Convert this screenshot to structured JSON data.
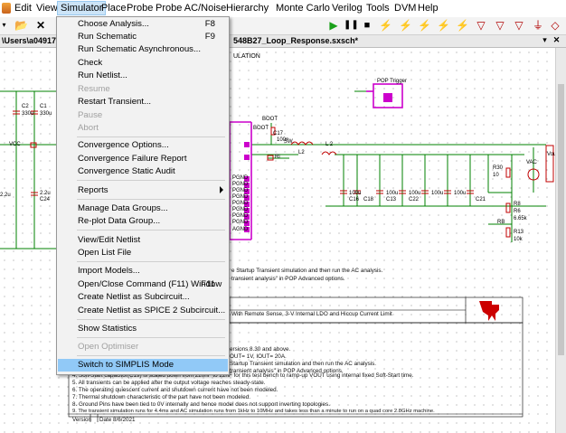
{
  "menubar": {
    "items": [
      "Edit",
      "View",
      "Simulator",
      "Place",
      "Probe",
      "Probe AC/Noise",
      "Hierarchy",
      "Monte Carlo",
      "Verilog",
      "Tools",
      "DVM",
      "Help"
    ]
  },
  "tabbar": {
    "path": "\\Users\\a049170",
    "document": "548B27_Loop_Response.sxsch*"
  },
  "simulator_menu": {
    "items": [
      {
        "label": "Choose Analysis...",
        "shortcut": "F8",
        "enabled": true
      },
      {
        "label": "Run Schematic",
        "shortcut": "F9",
        "enabled": true
      },
      {
        "label": "Run Schematic Asynchronous...",
        "shortcut": "",
        "enabled": true
      },
      {
        "label": "Check",
        "shortcut": "",
        "enabled": true
      },
      {
        "label": "Run Netlist...",
        "shortcut": "",
        "enabled": true
      },
      {
        "label": "Resume",
        "shortcut": "",
        "enabled": false
      },
      {
        "label": "Restart Transient...",
        "shortcut": "",
        "enabled": true
      },
      {
        "label": "Pause",
        "shortcut": "",
        "enabled": false
      },
      {
        "label": "Abort",
        "shortcut": "",
        "enabled": false
      },
      {
        "label": "Convergence Options...",
        "shortcut": "",
        "enabled": true
      },
      {
        "label": "Convergence Failure Report",
        "shortcut": "",
        "enabled": true
      },
      {
        "label": "Convergence Static Audit",
        "shortcut": "",
        "enabled": true
      },
      {
        "label": "Reports",
        "shortcut": "",
        "enabled": true,
        "submenu": true
      },
      {
        "label": "Manage Data Groups...",
        "shortcut": "",
        "enabled": true
      },
      {
        "label": "Re-plot Data Group...",
        "shortcut": "",
        "enabled": true
      },
      {
        "label": "View/Edit Netlist",
        "shortcut": "",
        "enabled": true
      },
      {
        "label": "Open List File",
        "shortcut": "",
        "enabled": true
      },
      {
        "label": "Import Models...",
        "shortcut": "",
        "enabled": true
      },
      {
        "label": "Open/Close Command (F11) Window",
        "shortcut": "F11",
        "enabled": true
      },
      {
        "label": "Create Netlist as Subcircuit...",
        "shortcut": "",
        "enabled": true
      },
      {
        "label": "Create Netlist as SPICE 2 Subcircuit...",
        "shortcut": "",
        "enabled": true
      },
      {
        "label": "Show Statistics",
        "shortcut": "",
        "enabled": true
      },
      {
        "label": "Open Optimiser",
        "shortcut": "",
        "enabled": false
      },
      {
        "label": "Switch to SIMPLIS Mode",
        "shortcut": "",
        "enabled": true,
        "highlighted": true
      }
    ]
  },
  "schematic": {
    "sheet_label": "ULATION",
    "pop_trigger": "POP Trigger",
    "labels": [
      "BOOT",
      "C17",
      "100n",
      "BOOT",
      "SW",
      "L2",
      "L 2",
      "Ri",
      "PGND",
      "PGND",
      "PGND",
      "PGND",
      "PGND",
      "PGND",
      "PGND",
      "PGND",
      "AGND",
      "VCC",
      "R30",
      "VAC",
      "Vout",
      "R8",
      "R13",
      "RB",
      "C16",
      "C18",
      "C13",
      "C22",
      "C24",
      "C1",
      "C2",
      "C21",
      "R6",
      "100u",
      "100u",
      "100u",
      "100u",
      "100u",
      "330u",
      "330u",
      "2.2u",
      "2.2u",
      "10k",
      "6.65k",
      "10"
    ],
    "notes_upper": [
      "e Startup Transient simulation and then run the AC analysis.",
      "transient analysis\" in POP Advanced options."
    ],
    "title_block": "With Remote Sense, 3-V Internal LDO and Hiccup Current Limit",
    "notes": [
      "ersions 8.30 and above.",
      "OUT= 1V, IOUT= 20A.",
      "Startup Transient simulation and then run the AC analysis.",
      "transient analysis\" in POP Advanced options.",
      "4.   Soft-Start capacitor(C19) is scaled down from 220nF to 22nF for this test bench to ramp-up VOUT using internal fixed Soft-Start time.",
      "5.   All transients can be applied after the output voltage reaches steady-state.",
      "6.   The operating quiescent current and shutdown current have not been modeled.",
      "7.   Thermal shutdown characteristic of the part have not been modeled.",
      "8.   Ground Pins have been tied to 0V internally and hence model does not support inverting topologies.",
      "9.   The transient simulation runs for 4.4ms and AC simulation runs from 1kHz to 10MHz and takes less than a minute to run on a quad core 2.8GHz machine."
    ],
    "version_label": "Version",
    "date_label": "Date  8/6/2021"
  },
  "colors": {
    "wire": "#008000",
    "bus": "#cc00cc",
    "part": "#c00000",
    "menu_highlight": "#91c9f7",
    "ti_logo": "#cc0000"
  },
  "icons": [
    "folder-open-icon",
    "save-icon",
    "close-icon",
    "run-icon",
    "pause-icon",
    "stop-icon",
    "probe-icon",
    "diode-icon"
  ]
}
